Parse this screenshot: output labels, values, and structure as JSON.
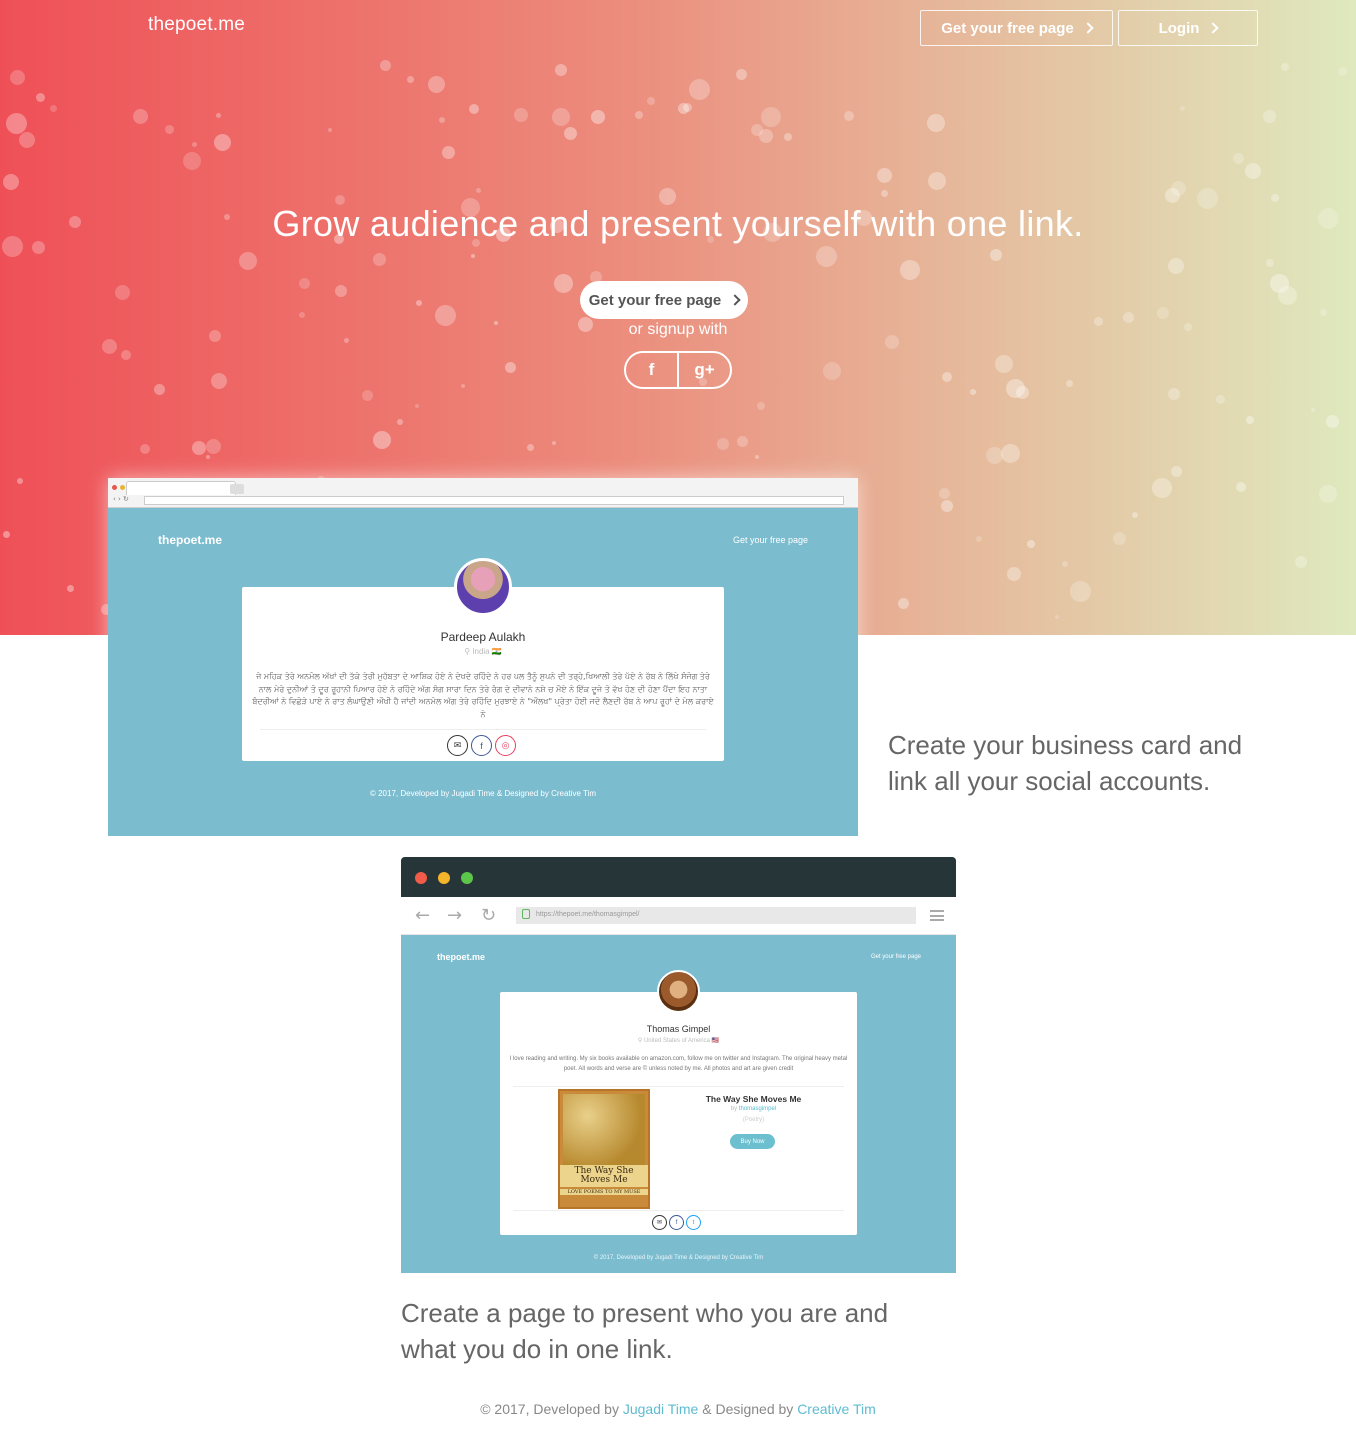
{
  "header": {
    "brand": "thepoet.me",
    "nav_free_page": "Get your free page",
    "nav_login": "Login"
  },
  "hero": {
    "headline": "Grow audience and present yourself with one link.",
    "cta_label": "Get your free page",
    "or_signup": "or signup with",
    "social": [
      {
        "name": "facebook",
        "glyph": "f"
      },
      {
        "name": "google-plus",
        "glyph": "g+"
      }
    ]
  },
  "shot1": {
    "brand": "thepoet.me",
    "free_page": "Get your free page",
    "profile_name": "Pardeep Aulakh",
    "location": "India 🇮🇳",
    "bio": "ਜੇ ਮਹਿਕ ਤੇਰੇ ਅਨਮੋਲ ਅੱਖਾਂ ਦੀ ਤੱਕੇ ਤੇਰੀ ਮੁਹੱਬਤਾ ਦੇ ਆਸ਼ਿਕ ਹੋਏ ਨੇ ਦੇਖਦੇ ਰਹਿੰਦੇ ਨੇ ਹਰ ਪਲ ਤੈਨੂੰ ਸੁਪਨੇ ਦੀ ਤਰ੍ਹੇ,ਖਿਆਲੀ ਤੇਰੇ ਪੱਏ ਨੇ ਰੱਬ ਨੇ ਲਿੱਖੇ ਸੰਜੋਗ ਤੇਰੇ ਨਾਲ ਮੇਰੇ ਦੁਨੀਆਂ ਤੋ ਦੂਰ ਰੂਹਾਨੀ ਪਿਆਰ ਹੋਏ ਨੇ ਰਹਿੰਦੇ ਅੱਗ ਸੰਗ ਸਾਰਾ ਦਿਨ ਤੇਰੇ ਰੰਗ ਦੇ ਦੀਵਾਨੇ ਨਸ਼ੇ ਚ ਮੌਏ ਨੇ ਇੱਕ ਦੂਜੇ ਤੋ ਵੱਖ ਹੋਣ ਦੀ ਹੋਣਾ ਪੈਂਦਾ ਇਹ ਨਾਤਾ ਬੰਦਰੀਆਂ ਨੇ ਵਿਛੋੜੇ ਪਾਏ ਨੇ ਰਾਤ ਲੰਘਾਉਣੀ ਔਖੀ ਹੈ ਜਾਂਦੀ ਅਨਮੋਲ ਅੱਗ ਤੇਰੇ ਰਹਿੰਦਿ ਮੁਰਝਾਏ ਨੇ \"ਔਲਖ\" ਪ੍ਰੇਤਾ ਹੋਈ ਜਦੋ ਲੈਣਦੀ ਰੱਬ ਨੇ ਆਪ ਰੂਹਾਂ ਦੇ ਮੇਲ ਕਰਾਏ ਨੇ",
    "footer": "© 2017, Developed by Jugadi Time & Designed by Creative Tim"
  },
  "caption1": "Create your business card and link all your social accounts.",
  "shot2": {
    "url": "https://thepoet.me/thomasgimpel/",
    "brand": "thepoet.me",
    "free_page": "Get your free page",
    "profile_name": "Thomas Gimpel",
    "location": "United States of America 🇺🇸",
    "bio": "I love reading and writing. My six books available on amazon.com, follow me on twitter and Instagram. The original heavy metal poet. All words and verse are © unless noted by me. All photos and art are given credit",
    "book_cover_title": "The Way She Moves Me",
    "book_cover_subtitle": "LOVE POEMS TO MY MUSE",
    "book_title": "The Way She Moves Me",
    "book_by_prefix": "by",
    "book_author": "thomasgimpel",
    "book_genre": "(Poetry)",
    "buy_label": "Buy Now",
    "footer": "© 2017, Developed by Jugadi Time & Designed by Creative Tim"
  },
  "caption2": "Create a page to present who you are and what you do in one link.",
  "footer": {
    "prefix": "© 2017, Developed by",
    "dev": "Jugadi Time",
    "mid": "& Designed by",
    "designer": "Creative Tim"
  },
  "colors": {
    "hero_left": "#ef5057",
    "hero_right": "#dfe9be",
    "profile_bg": "#7cbccf",
    "link": "#5cbcd0"
  }
}
